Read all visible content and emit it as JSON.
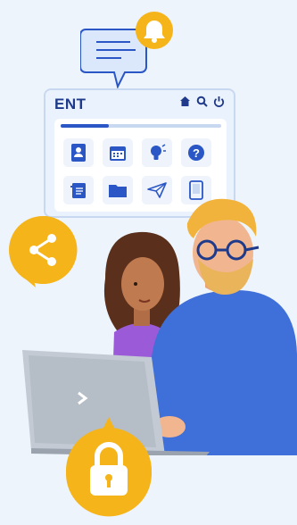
{
  "panel": {
    "title": "ENT",
    "progress_fraction": 0.3
  },
  "icons": {
    "panel_top": [
      "home-icon",
      "search-icon",
      "power-icon"
    ],
    "tiles": [
      "contacts-icon",
      "calendar-icon",
      "idea-icon",
      "help-icon",
      "document-icon",
      "folder-icon",
      "send-icon",
      "tablet-icon"
    ],
    "floating": [
      "message-bubble-icon",
      "bell-icon",
      "share-icon",
      "lock-icon"
    ]
  },
  "colors": {
    "background": "#eef4fb",
    "brand_blue": "#2a56c6",
    "accent_yellow": "#f5b41a",
    "shirt_blue": "#3f6fd8",
    "laptop_grey": "#c3cad3"
  }
}
